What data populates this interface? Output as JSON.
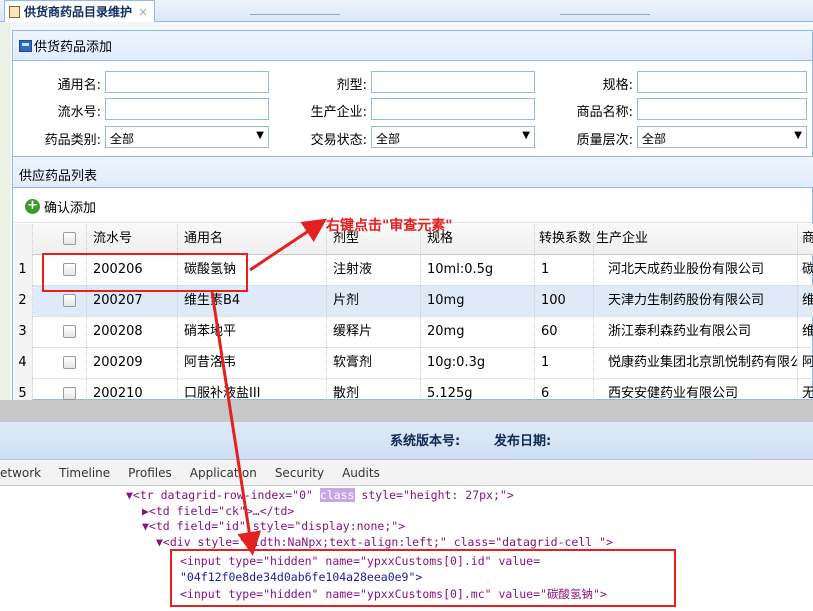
{
  "tab": {
    "title": "供货商药品目录维护"
  },
  "panel": {
    "title": "供货药品添加"
  },
  "search": {
    "generic_name_label": "通用名:",
    "dosage_form_label": "剂型:",
    "spec_label": "规格:",
    "serial_label": "流水号:",
    "manufacturer_label": "生产企业:",
    "product_name_label": "商品名称:",
    "category_label": "药品类别:",
    "category_value": "全部",
    "trade_status_label": "交易状态:",
    "trade_status_value": "全部",
    "quality_label": "质量层次:",
    "quality_value": "全部"
  },
  "list": {
    "title": "供应药品列表",
    "confirm_add_label": "确认添加"
  },
  "grid": {
    "headers": [
      "流水号",
      "通用名",
      "剂型",
      "规格",
      "转换系数",
      "生产企业",
      "商"
    ],
    "rows": [
      {
        "n": "1",
        "serial": "200206",
        "name": "碳酸氢钠",
        "form": "注射液",
        "spec": "10ml:0.5g",
        "factor": "1",
        "maker": "河北天成药业股份有限公司",
        "tail": "碳"
      },
      {
        "n": "2",
        "serial": "200207",
        "name": "维生素B4",
        "form": "片剂",
        "spec": "10mg",
        "factor": "100",
        "maker": "天津力生制药股份有限公司",
        "tail": "维"
      },
      {
        "n": "3",
        "serial": "200208",
        "name": "硝苯地平",
        "form": "缓释片",
        "spec": "20mg",
        "factor": "60",
        "maker": "浙江泰利森药业有限公司",
        "tail": "维"
      },
      {
        "n": "4",
        "serial": "200209",
        "name": "阿昔洛韦",
        "form": "软膏剂",
        "spec": "10g:0.3g",
        "factor": "1",
        "maker": "悦康药业集团北京凯悦制药有限公司",
        "tail": "阿"
      },
      {
        "n": "5",
        "serial": "200210",
        "name": "口服补液盐III",
        "form": "散剂",
        "spec": "5.125g",
        "factor": "6",
        "maker": "西安安健药业有限公司",
        "tail": "无"
      }
    ]
  },
  "footer": {
    "version_label": "系统版本号:",
    "release_label": "发布日期:"
  },
  "devtools": {
    "tabs": [
      "etwork",
      "Timeline",
      "Profiles",
      "Application",
      "Security",
      "Audits"
    ],
    "lines": {
      "l1_prefix": "▼<tr datagrid-row-index=\"0\" ",
      "l1_class": "class",
      "l1_suffix": " style=\"height: 27px;\">",
      "l2": "▶<td field=\"ck\">…</td>",
      "l3": "▼<td field=\"id\" style=\"display:none;\">",
      "l4": "▼<div style=\"width:NaNpx;text-align:left;\" class=\"datagrid-cell \">",
      "l5": "<input type=\"hidden\" name=\"ypxxCustoms[0].id\" value=",
      "l6": "\"04f12f0e8de34d0ab6fe104a28eea0e9\">",
      "l7": "<input type=\"hidden\" name=\"ypxxCustoms[0].mc\" value=\"碳酸氢钠\">"
    }
  },
  "annotation": {
    "text": "右键点击\"审查元素\"",
    "color": "#e52020"
  }
}
